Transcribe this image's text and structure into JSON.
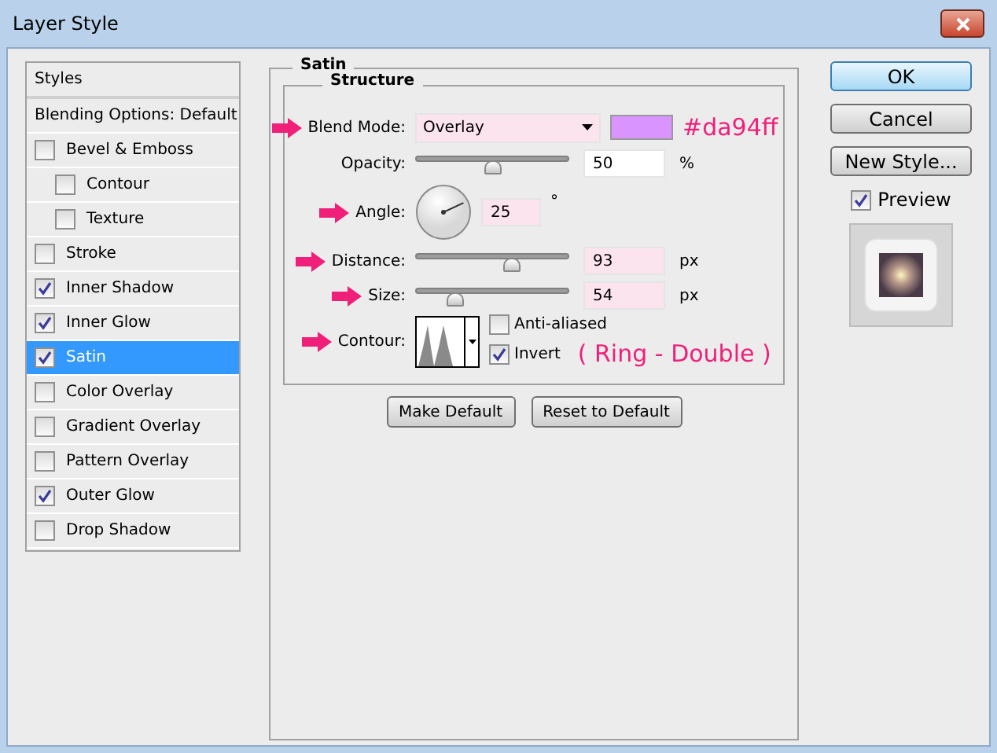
{
  "window": {
    "title": "Layer Style"
  },
  "styles_panel": {
    "header": "Styles",
    "items": [
      {
        "label": "Blending Options: Default",
        "kind": "plain",
        "selected": false
      },
      {
        "label": "Bevel & Emboss",
        "kind": "checkbox",
        "checked": false,
        "selected": false,
        "children": [
          {
            "label": "Contour",
            "kind": "checkbox",
            "checked": false,
            "selected": false
          },
          {
            "label": "Texture",
            "kind": "checkbox",
            "checked": false,
            "selected": false
          }
        ]
      },
      {
        "label": "Stroke",
        "kind": "checkbox",
        "checked": false,
        "selected": false
      },
      {
        "label": "Inner Shadow",
        "kind": "checkbox",
        "checked": true,
        "selected": false
      },
      {
        "label": "Inner Glow",
        "kind": "checkbox",
        "checked": true,
        "selected": false
      },
      {
        "label": "Satin",
        "kind": "checkbox",
        "checked": true,
        "selected": true
      },
      {
        "label": "Color Overlay",
        "kind": "checkbox",
        "checked": false,
        "selected": false
      },
      {
        "label": "Gradient Overlay",
        "kind": "checkbox",
        "checked": false,
        "selected": false
      },
      {
        "label": "Pattern Overlay",
        "kind": "checkbox",
        "checked": false,
        "selected": false
      },
      {
        "label": "Outer Glow",
        "kind": "checkbox",
        "checked": true,
        "selected": false
      },
      {
        "label": "Drop Shadow",
        "kind": "checkbox",
        "checked": false,
        "selected": false
      }
    ]
  },
  "satin": {
    "title": "Satin",
    "structure": {
      "title": "Structure",
      "rows": [
        {
          "kind": "dropdown",
          "arrow": true,
          "label": "Blend Mode:",
          "value": "Overlay",
          "color": "#da94ff",
          "note": "#da94ff"
        },
        {
          "kind": "slider",
          "arrow": false,
          "label": "Opacity:",
          "value": "50",
          "unit": "%",
          "level": 0.5,
          "tinted": false
        },
        {
          "kind": "angle",
          "arrow": true,
          "label": "Angle:",
          "value": "25",
          "unit": "°"
        },
        {
          "kind": "slider",
          "arrow": true,
          "label": "Distance:",
          "value": "93",
          "unit": "px",
          "level": 0.62,
          "tinted": true
        },
        {
          "kind": "slider",
          "arrow": true,
          "label": "Size:",
          "value": "54",
          "unit": "px",
          "level": 0.26,
          "tinted": true
        },
        {
          "kind": "contour",
          "arrow": true,
          "label": "Contour:",
          "anti_aliased": {
            "label": "Anti-aliased",
            "checked": false
          },
          "invert": {
            "label": "Invert",
            "checked": true
          },
          "note": "( Ring - Double )"
        }
      ]
    },
    "buttons": [
      "Make Default",
      "Reset to Default"
    ]
  },
  "actions": [
    {
      "label": "OK",
      "default": true
    },
    {
      "label": "Cancel",
      "default": false
    },
    {
      "label": "New Style...",
      "default": false
    }
  ],
  "preview": {
    "label": "Preview",
    "checked": true
  }
}
